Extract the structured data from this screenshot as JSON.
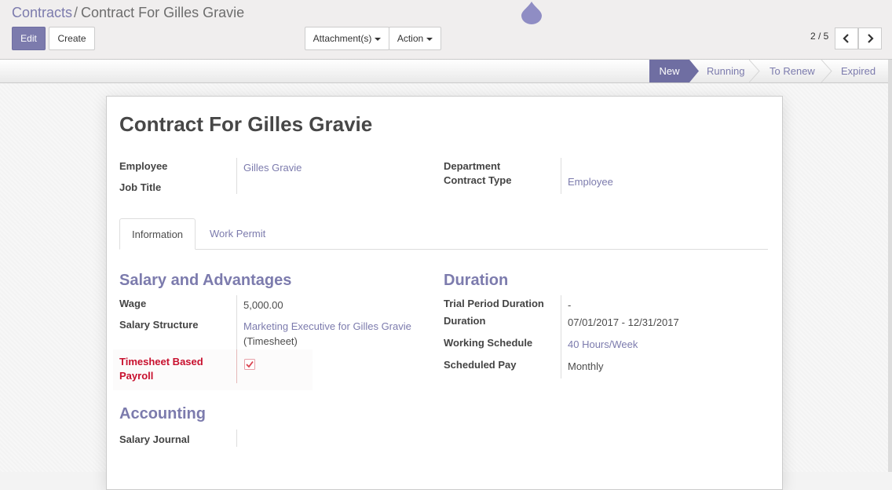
{
  "breadcrumb": {
    "parent": "Contracts",
    "separator": "/",
    "current": "Contract For Gilles Gravie"
  },
  "toolbar": {
    "edit_label": "Edit",
    "create_label": "Create",
    "attachments_label": "Attachment(s)",
    "action_label": "Action"
  },
  "pager": {
    "value": "2 / 5",
    "prev_icon": "chevron-left-icon",
    "next_icon": "chevron-right-icon"
  },
  "statusbar": {
    "stages": [
      {
        "label": "New",
        "active": true
      },
      {
        "label": "Running",
        "active": false
      },
      {
        "label": "To Renew",
        "active": false
      },
      {
        "label": "Expired",
        "active": false
      }
    ]
  },
  "form": {
    "title": "Contract For Gilles Gravie",
    "employee_label": "Employee",
    "employee_value": "Gilles Gravie",
    "job_title_label": "Job Title",
    "department_label": "Department",
    "contract_type_label": "Contract Type",
    "contract_type_value": "Employee"
  },
  "tabs": [
    {
      "label": "Information",
      "active": true
    },
    {
      "label": "Work Permit",
      "active": false
    }
  ],
  "salary": {
    "section_title": "Salary and Advantages",
    "wage_label": "Wage",
    "wage_value": "5,000.00",
    "structure_label": "Salary Structure",
    "structure_value": "Marketing Executive for Gilles Gravie",
    "structure_suffix": "(Timesheet)",
    "timesheet_label_line1": "Timesheet Based",
    "timesheet_label_line2": "Payroll",
    "timesheet_checked": true
  },
  "duration": {
    "section_title": "Duration",
    "trial_label": "Trial Period Duration",
    "trial_value": "-",
    "duration_label": "Duration",
    "duration_value": "07/01/2017 - 12/31/2017",
    "schedule_label": "Working Schedule",
    "schedule_value": "40 Hours/Week",
    "pay_label": "Scheduled Pay",
    "pay_value": "Monthly"
  },
  "accounting": {
    "section_title": "Accounting",
    "journal_label": "Salary Journal"
  },
  "colors": {
    "brand": "#7c7bad",
    "active_stage": "#6f6ea2",
    "required": "#c8102e"
  }
}
